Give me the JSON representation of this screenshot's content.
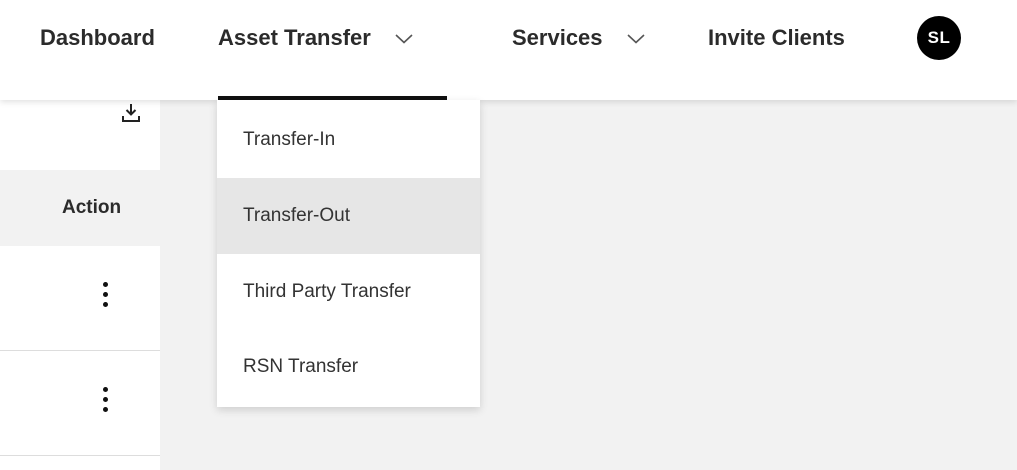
{
  "nav": {
    "items": [
      {
        "label": "Dashboard"
      },
      {
        "label": "Asset Transfer",
        "has_dropdown": true,
        "active": true
      },
      {
        "label": "Services",
        "has_dropdown": true
      },
      {
        "label": "Invite Clients"
      }
    ],
    "avatar_initials": "SL"
  },
  "dropdown": {
    "items": [
      {
        "label": "Transfer-In"
      },
      {
        "label": "Transfer-Out",
        "highlighted": true
      },
      {
        "label": "Third Party Transfer"
      },
      {
        "label": "RSN Transfer"
      }
    ]
  },
  "table": {
    "header_action": "Action",
    "rows": [
      {
        "action_icon": "more-vertical-icon"
      },
      {
        "action_icon": "more-vertical-icon"
      }
    ],
    "download_icon": "download-icon"
  },
  "colors": {
    "nav_background": "#ffffff",
    "page_background": "#f2f2f2",
    "active_underline": "#111111",
    "avatar_background": "#000000",
    "dropdown_highlight": "#e6e6e6"
  }
}
